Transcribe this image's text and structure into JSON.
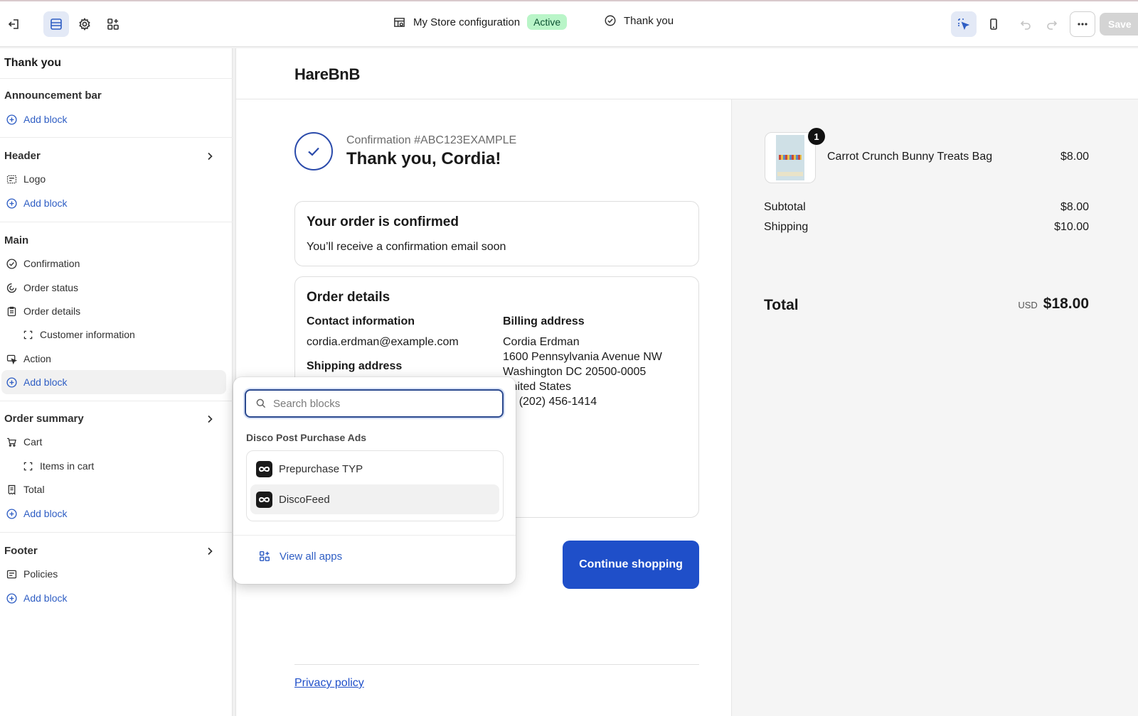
{
  "topbar": {
    "store_config": "My Store configuration",
    "status_badge": "Active",
    "page_name": "Thank you",
    "save_label": "Save"
  },
  "sidebar": {
    "title": "Thank you",
    "sections": {
      "announcement": "Announcement bar",
      "header": "Header",
      "main": "Main",
      "order_summary": "Order summary",
      "footer": "Footer"
    },
    "add_block": "Add block",
    "items": {
      "logo": "Logo",
      "confirmation": "Confirmation",
      "order_status": "Order status",
      "order_details": "Order details",
      "customer_information": "Customer information",
      "action": "Action",
      "cart": "Cart",
      "items_in_cart": "Items in cart",
      "total": "Total",
      "policies": "Policies"
    }
  },
  "preview": {
    "store_name": "HareBnB",
    "confirmation_number": "Confirmation #ABC123EXAMPLE",
    "thank_you": "Thank you, Cordia!",
    "confirmed_card": {
      "title": "Your order is confirmed",
      "text": "You’ll receive a confirmation email soon"
    },
    "order_details": {
      "title": "Order details",
      "contact_heading": "Contact information",
      "contact_email": "cordia.erdman@example.com",
      "shipping_heading": "Shipping address",
      "billing_heading": "Billing address",
      "billing_lines": [
        "Cordia Erdman",
        "1600 Pennsylvania Avenue NW",
        "Washington DC 20500-0005",
        "United States",
        "+1 (202) 456-1414"
      ]
    },
    "continue_label": "Continue shopping",
    "privacy_label": "Privacy policy"
  },
  "summary": {
    "quantity": "1",
    "product_name": "Carrot Crunch Bunny Treats Bag",
    "product_price": "$8.00",
    "subtotal_label": "Subtotal",
    "subtotal_value": "$8.00",
    "shipping_label": "Shipping",
    "shipping_value": "$10.00",
    "total_label": "Total",
    "total_currency": "USD",
    "total_value": "$18.00"
  },
  "popover": {
    "search_placeholder": "Search blocks",
    "section_title": "Disco Post Purchase Ads",
    "apps": [
      "Prepurchase TYP",
      "DiscoFeed"
    ],
    "view_all": "View all apps"
  },
  "colors": {
    "accent_blue": "#1f4fc9",
    "link_blue": "#2f5ec4",
    "active_badge_bg": "#b9f5c8"
  }
}
